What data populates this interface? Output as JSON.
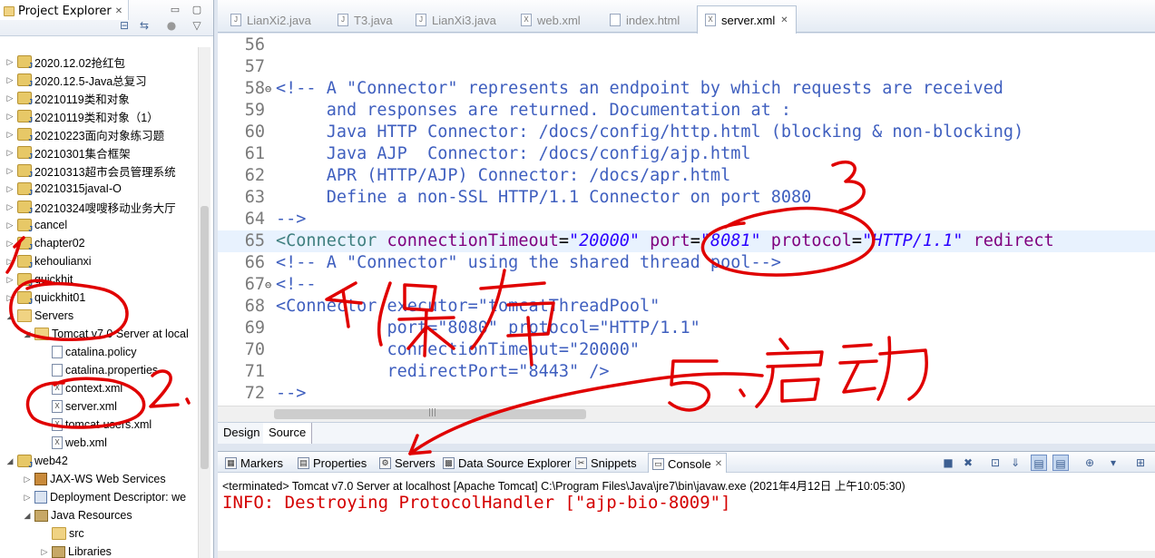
{
  "explorer": {
    "title": "Project Explorer",
    "close_glyph": "✕",
    "tree": [
      {
        "label": "2020.12.02抢红包",
        "icon": "project-icon",
        "twisty": "▷"
      },
      {
        "label": "2020.12.5-Java总复习",
        "icon": "project-icon",
        "twisty": "▷"
      },
      {
        "label": "20210119类和对象",
        "icon": "project-icon",
        "twisty": "▷"
      },
      {
        "label": "20210119类和对象（1）",
        "icon": "project-icon",
        "twisty": "▷"
      },
      {
        "label": "20210223面向对象练习题",
        "icon": "project-icon",
        "twisty": "▷"
      },
      {
        "label": "20210301集合框架",
        "icon": "project-icon",
        "twisty": "▷"
      },
      {
        "label": "20210313超市会员管理系统",
        "icon": "project-icon",
        "twisty": "▷"
      },
      {
        "label": "20210315javaI-O",
        "icon": "project-icon",
        "twisty": "▷"
      },
      {
        "label": "20210324嗖嗖移动业务大厅",
        "icon": "project-icon",
        "twisty": "▷"
      },
      {
        "label": "cancel",
        "icon": "project-icon",
        "twisty": "▷"
      },
      {
        "label": "chapter02",
        "icon": "project-icon",
        "twisty": "▷"
      },
      {
        "label": "kehoulianxi",
        "icon": "project-icon",
        "twisty": "▷"
      },
      {
        "label": "quickhit",
        "icon": "project-icon",
        "twisty": "▷"
      },
      {
        "label": "quickhit01",
        "icon": "project-icon",
        "twisty": "▷"
      },
      {
        "label": "Servers",
        "icon": "folder-icon",
        "twisty": "◢"
      },
      {
        "label": "Tomcat v7.0 Server at local",
        "icon": "folder-icon",
        "twisty": "◢"
      },
      {
        "label": "catalina.policy",
        "icon": "file-icon",
        "twisty": ""
      },
      {
        "label": "catalina.properties",
        "icon": "file-icon",
        "twisty": ""
      },
      {
        "label": "context.xml",
        "icon": "xml-file-icon",
        "twisty": ""
      },
      {
        "label": "server.xml",
        "icon": "xml-file-icon",
        "twisty": ""
      },
      {
        "label": "tomcat-users.xml",
        "icon": "xml-file-icon",
        "twisty": ""
      },
      {
        "label": "web.xml",
        "icon": "xml-file-icon",
        "twisty": ""
      },
      {
        "label": "web42",
        "icon": "project-icon",
        "twisty": "◢"
      },
      {
        "label": "JAX-WS Web Services",
        "icon": "service-icon",
        "twisty": "▷"
      },
      {
        "label": "Deployment Descriptor: we",
        "icon": "descriptor-icon",
        "twisty": "▷"
      },
      {
        "label": "Java Resources",
        "icon": "library-icon",
        "twisty": "◢"
      },
      {
        "label": "src",
        "icon": "folder-icon",
        "twisty": ""
      },
      {
        "label": "Libraries",
        "icon": "library-icon",
        "twisty": "▷"
      }
    ]
  },
  "editor_tabs": [
    {
      "label": "LianXi2.java",
      "icon": "java-file-icon",
      "active": false
    },
    {
      "label": "T3.java",
      "icon": "java-file-icon",
      "active": false
    },
    {
      "label": "LianXi3.java",
      "icon": "java-file-icon",
      "active": false
    },
    {
      "label": "web.xml",
      "icon": "xml-file-icon",
      "active": false
    },
    {
      "label": "index.html",
      "icon": "html-file-icon",
      "active": false
    },
    {
      "label": "server.xml",
      "icon": "xml-file-icon",
      "active": true
    }
  ],
  "editor_lines": [
    {
      "n": "56",
      "segments": []
    },
    {
      "n": "57",
      "segments": []
    },
    {
      "n": "58",
      "fold": "⊖",
      "segments": [
        {
          "t": "<!-- A \"Connector\" represents an endpoint by which requests are received",
          "c": "comment"
        }
      ]
    },
    {
      "n": "59",
      "segments": [
        {
          "t": "     and responses are returned. Documentation at :",
          "c": "comment"
        }
      ]
    },
    {
      "n": "60",
      "segments": [
        {
          "t": "     Java HTTP Connector: /docs/config/http.html (blocking & non-blocking)",
          "c": "comment"
        }
      ]
    },
    {
      "n": "61",
      "segments": [
        {
          "t": "     Java AJP  Connector: /docs/config/ajp.html",
          "c": "comment"
        }
      ]
    },
    {
      "n": "62",
      "segments": [
        {
          "t": "     APR (HTTP/AJP) Connector: /docs/apr.html",
          "c": "comment"
        }
      ]
    },
    {
      "n": "63",
      "segments": [
        {
          "t": "     Define a non-SSL HTTP/1.1 Connector on port 8080",
          "c": "comment"
        }
      ]
    },
    {
      "n": "64",
      "segments": [
        {
          "t": "-->",
          "c": "comment"
        }
      ]
    },
    {
      "n": "65",
      "current": true,
      "segments": [
        {
          "t": "<Connector ",
          "c": "tag"
        },
        {
          "t": "connectionTimeout",
          "c": "attr"
        },
        {
          "t": "=",
          "c": "plain"
        },
        {
          "t": "\"20000\"",
          "c": "val"
        },
        {
          "t": " port",
          "c": "attr"
        },
        {
          "t": "=",
          "c": "plain"
        },
        {
          "t": "\"8081\"",
          "c": "val"
        },
        {
          "t": " protocol",
          "c": "attr"
        },
        {
          "t": "=",
          "c": "plain"
        },
        {
          "t": "\"HTTP/1.1\"",
          "c": "val"
        },
        {
          "t": " redirect",
          "c": "attr"
        }
      ]
    },
    {
      "n": "66",
      "segments": [
        {
          "t": "<!-- A \"Connector\" using the shared thread pool-->",
          "c": "comment"
        }
      ]
    },
    {
      "n": "67",
      "fold": "⊖",
      "segments": [
        {
          "t": "<!--",
          "c": "comment"
        }
      ]
    },
    {
      "n": "68",
      "segments": [
        {
          "t": "<Connector executor=\"tomcatThreadPool\"",
          "c": "comment"
        }
      ]
    },
    {
      "n": "69",
      "segments": [
        {
          "t": "           port=\"8080\" protocol=\"HTTP/1.1\"",
          "c": "comment"
        }
      ]
    },
    {
      "n": "70",
      "segments": [
        {
          "t": "           connectionTimeout=\"20000\"",
          "c": "comment"
        }
      ]
    },
    {
      "n": "71",
      "segments": [
        {
          "t": "           redirectPort=\"8443\" />",
          "c": "comment"
        }
      ]
    },
    {
      "n": "72",
      "segments": [
        {
          "t": "-->",
          "c": "comment"
        }
      ]
    }
  ],
  "design_tabs": {
    "design": "Design",
    "source": "Source"
  },
  "console_tabs": [
    {
      "label": "Markers",
      "icon": "markers-icon",
      "active": false
    },
    {
      "label": "Properties",
      "icon": "properties-icon",
      "active": false
    },
    {
      "label": "Servers",
      "icon": "servers-icon",
      "active": false
    },
    {
      "label": "Data Source Explorer",
      "icon": "datasource-icon",
      "active": false
    },
    {
      "label": "Snippets",
      "icon": "snippets-icon",
      "active": false
    },
    {
      "label": "Console",
      "icon": "console-icon",
      "active": true
    }
  ],
  "console": {
    "header": "<terminated> Tomcat v7.0 Server at localhost [Apache Tomcat] C:\\Program Files\\Java\\jre7\\bin\\javaw.exe (2021年4月12日 上午10:05:30)",
    "output": "INFO: Destroying ProtocolHandler [\"ajp-bio-8009\"]"
  },
  "colors": {
    "comment": "#3f5fbf",
    "tag": "#3f7f7f",
    "attr": "#7f007f",
    "value": "#2a00ff",
    "console_error": "#d40000",
    "annotation": "#e00000"
  }
}
